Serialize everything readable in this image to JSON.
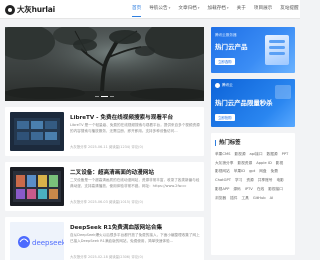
{
  "header": {
    "logo_text": "大灰hurlai",
    "nav": [
      {
        "label": "首页",
        "active": true,
        "caret": false
      },
      {
        "label": "导航公告",
        "active": false,
        "caret": true
      },
      {
        "label": "文章归档",
        "active": false,
        "caret": true
      },
      {
        "label": "加载存档",
        "active": false,
        "caret": true
      },
      {
        "label": "关于",
        "active": false,
        "caret": false
      },
      {
        "label": "项目展示",
        "active": false,
        "caret": false
      },
      {
        "label": "友站提醒",
        "active": false,
        "caret": false
      }
    ]
  },
  "hero": {
    "slide_count": 3,
    "active_slide": 1
  },
  "posts": [
    {
      "title": "LibreTV - 免费在线视频搜索与观看平台",
      "excerpt": "LibreTV 是一个轻量级、免费的在线视频搜索与观看平台，提供来自多个视频资源的内容搜索与播放服务，无需注册，即开即用。支持多种设备访问...",
      "meta": "大灰狼分享   2025-06-11   阅读量(1234)   评论(0)",
      "thumb": "libretv"
    },
    {
      "title": "二叉设备：超高清画面的动漫网站",
      "excerpt": "二叉设备是一个超高清画质的在线动漫网站，资源非常丰富，收录了各类新番与经典动漫，支持高清播放，使用体验非常不错。网址：https://www.2fw.cc",
      "meta": "大灰狼分享   2025-06-03   阅读量(1015)   评论(0)",
      "thumb": "anime"
    },
    {
      "title": "DeepSeek R1免费满血版网站合集",
      "excerpt": "自从DeepSeek爆火以后很多平台都开放了免费的接入，下面小编整理收集了网上已接入DeepSeek R1满血版的网站，免费使用，简单快速体验...",
      "meta": "大灰狼分享   2025-02-18   阅读量(2306)   评论(0)",
      "thumb": "deepseek"
    }
  ],
  "ads": [
    {
      "small": "腾讯云服务器",
      "big": "热门云产品",
      "chip": "立即选购"
    },
    {
      "small": "腾讯云",
      "big": "热门云产品限量秒杀",
      "chip": "立即抢购"
    }
  ],
  "tags": {
    "title": "热门标签",
    "items": [
      "苹果CMS",
      "影视源",
      "api接口",
      "数据源",
      "PPT",
      "大灰狼分享",
      "影视资源",
      "Apple ID",
      "影视",
      "影视网站",
      "苹果ID",
      "gpt",
      "网盘",
      "免费",
      "ChatGPT",
      "学习",
      "资源",
      "共享账号",
      "电影",
      "影视APP",
      "源码",
      "IPTV",
      "在线",
      "影视接口",
      "浏览器",
      "插件",
      "工具",
      "GitHub",
      "AI"
    ]
  },
  "thumbs": {
    "deepseek_label": "deepseek"
  }
}
